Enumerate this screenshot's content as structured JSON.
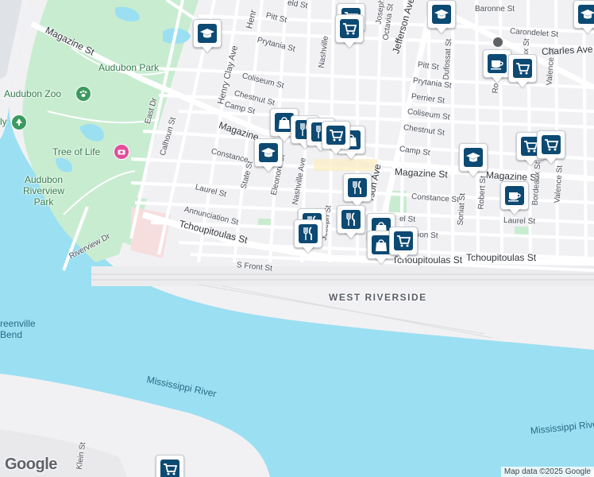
{
  "map": {
    "attribution": "Map data ©2025 Google",
    "logo_text": "Google",
    "colors": {
      "water": "#9bdff2",
      "park": "#c8ecd0",
      "land": "#f1f1f4",
      "road": "#ffffff",
      "marker_fill": "#0d4a73"
    }
  },
  "labels": {
    "magazine_st_1": "Magazine St",
    "magazine_st_2": "Magazine",
    "magazine_st_3": "Magazine St",
    "magazine_st_4": "Magazine St",
    "audubon_park": "Audubon Park",
    "audubon_zoo": "Audubon Zoo",
    "tree_of_life": "Tree of Life",
    "audubon_riverview_park": "Audubon Riverview Park",
    "riverview_dr": "Riverview Dr",
    "east_dr": "East Dr",
    "calhoun_st": "Calhoun St",
    "henry_clay_ave": "Henry Clay Ave",
    "henr": "Henr",
    "pitt_st": "Pitt St",
    "pitt_st_2": "Pitt St",
    "prytania_st": "Prytania St",
    "prytania_st_2": "Prytania St",
    "coliseum_st": "Coliseum St",
    "coliseum_st_2": "Coliseum St",
    "chestnut_st": "Chestnut St",
    "chestnut_st_2": "Chestnut St",
    "camp_st": "Camp St",
    "camp_st_2": "Camp St",
    "constance": "Constance",
    "constance_st": "Constance St",
    "laurel_st": "Laurel St",
    "laurel_st_2": "Laurel St",
    "el_st": "el St",
    "annunciation_st": "Annunciation St",
    "ion_st": "ion St",
    "state_st": "State St",
    "eleonore_st": "Eleonore St",
    "nashville_ave": "Nashville Ave",
    "nashville": "Nashville",
    "joseph": "Joseph",
    "joseph_st": "Joseph St",
    "octavia_st": "Octavia St",
    "jefferson_ave": "Jefferson Ave",
    "rson_ave": "rson Ave",
    "perrier_st": "Perrier St",
    "dufossat_st": "Dufossat St",
    "soniat_st": "Soniat St",
    "robert_st": "Robert St",
    "bordeaux_st": "Bordeaux St",
    "bordeaux_st_top": "Bordeaux St",
    "valence_st": "Valence St",
    "valence_st_top": "Valence St",
    "baronne_st": "Baronne St",
    "carondelet_st": "Carondelet St",
    "charles_ave": "Charles Ave",
    "tchoupitoulas_st": "Tchoupitoulas St",
    "tchoupitoulas_st_2": "Tchoupitoulas St",
    "tchoupitoulas_st_3": "Tchoupitoulas St",
    "s_front_st": "S Front St",
    "west_riverside": "WEST RIVERSIDE",
    "reenville_bend": "reenville Bend",
    "mississippi_river": "Mississippi River",
    "mississippi_river_2": "Mississippi River",
    "klein_st": "Klein St",
    "eld_st": "eld St",
    "ly": "ly",
    "ro": "Ro"
  },
  "markers": [
    {
      "name": "school-icon",
      "type": "school"
    },
    {
      "name": "cart-icon",
      "type": "cart"
    },
    {
      "name": "cart-icon",
      "type": "cart"
    },
    {
      "name": "shopping-bag-icon",
      "type": "bag"
    },
    {
      "name": "restaurant-icon",
      "type": "restaurant"
    },
    {
      "name": "restaurant-icon",
      "type": "restaurant"
    },
    {
      "name": "school-icon",
      "type": "school"
    },
    {
      "name": "shopping-bag-icon",
      "type": "bag"
    },
    {
      "name": "cart-icon",
      "type": "cart"
    },
    {
      "name": "restaurant-icon",
      "type": "restaurant"
    },
    {
      "name": "restaurant-icon",
      "type": "restaurant"
    },
    {
      "name": "restaurant-icon",
      "type": "restaurant"
    },
    {
      "name": "restaurant-icon",
      "type": "restaurant"
    },
    {
      "name": "shopping-bag-icon",
      "type": "bag"
    },
    {
      "name": "shopping-bag-icon",
      "type": "bag"
    },
    {
      "name": "cart-icon",
      "type": "cart"
    },
    {
      "name": "school-icon",
      "type": "school"
    },
    {
      "name": "cart-icon",
      "type": "cart"
    },
    {
      "name": "cart-icon",
      "type": "cart"
    },
    {
      "name": "coffee-icon",
      "type": "coffee"
    },
    {
      "name": "cart-icon",
      "type": "cart"
    },
    {
      "name": "coffee-icon",
      "type": "coffee"
    },
    {
      "name": "school-icon",
      "type": "school"
    },
    {
      "name": "school-icon",
      "type": "school"
    },
    {
      "name": "cart-icon",
      "type": "cart"
    }
  ]
}
